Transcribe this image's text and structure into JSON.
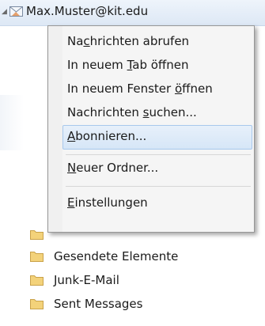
{
  "account": {
    "name": "Max.Muster@kit.edu"
  },
  "folders": [
    {
      "label": "Gesendete Elemente"
    },
    {
      "label": "Junk-E-Mail"
    },
    {
      "label": "Sent Messages"
    }
  ],
  "menu": {
    "items": [
      {
        "pre": "Na",
        "key": "c",
        "post": "hrichten abrufen"
      },
      {
        "pre": "In neuem ",
        "key": "T",
        "post": "ab öffnen"
      },
      {
        "pre": "In neuem Fenster ",
        "key": "ö",
        "post": "ffnen"
      },
      {
        "pre": "Nachrichten ",
        "key": "s",
        "post": "uchen..."
      },
      {
        "pre": "",
        "key": "A",
        "post": "bonnieren..."
      },
      {
        "pre": "",
        "key": "N",
        "post": "euer Ordner..."
      },
      {
        "pre": "",
        "key": "E",
        "post": "instellungen"
      }
    ],
    "highlighted_index": 4
  },
  "colors": {
    "highlight_bg": "#d9e8f8",
    "highlight_border": "#a8c8ec",
    "folder_yellow": "#f3d27a"
  }
}
